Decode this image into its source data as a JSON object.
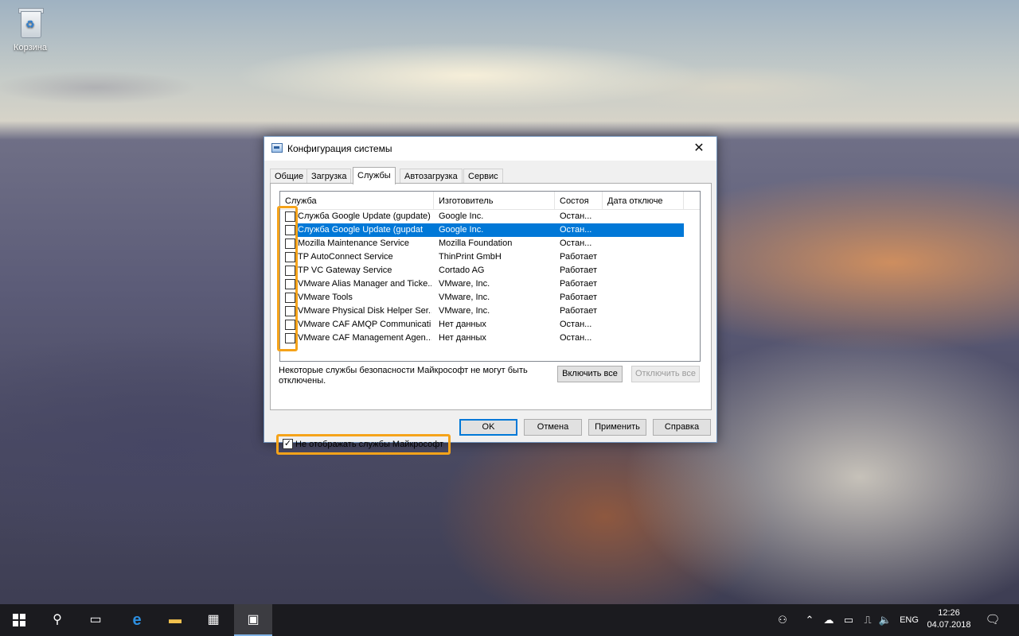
{
  "desktop": {
    "recycle_bin_label": "Корзина"
  },
  "dialog": {
    "title": "Конфигурация системы",
    "close_glyph": "✕",
    "tabs": [
      "Общие",
      "Загрузка",
      "Службы",
      "Автозагрузка",
      "Сервис"
    ],
    "active_tab": "Службы",
    "columns": [
      "Служба",
      "Изготовитель",
      "Состоя",
      "Дата отключе"
    ],
    "rows": [
      {
        "service": "Служба Google Update (gupdate)",
        "manufacturer": "Google Inc.",
        "status": "Остан...",
        "date": "",
        "checked": false,
        "selected": false
      },
      {
        "service": "Служба Google Update (gupdat",
        "manufacturer": "Google Inc.",
        "status": "Остан...",
        "date": "",
        "checked": false,
        "selected": true
      },
      {
        "service": "Mozilla Maintenance Service",
        "manufacturer": "Mozilla Foundation",
        "status": "Остан...",
        "date": "",
        "checked": false,
        "selected": false
      },
      {
        "service": "TP AutoConnect Service",
        "manufacturer": "ThinPrint GmbH",
        "status": "Работает",
        "date": "",
        "checked": false,
        "selected": false
      },
      {
        "service": "TP VC Gateway Service",
        "manufacturer": "Cortado AG",
        "status": "Работает",
        "date": "",
        "checked": false,
        "selected": false
      },
      {
        "service": "VMware Alias Manager and Ticke...",
        "manufacturer": "VMware, Inc.",
        "status": "Работает",
        "date": "",
        "checked": false,
        "selected": false
      },
      {
        "service": "VMware Tools",
        "manufacturer": "VMware, Inc.",
        "status": "Работает",
        "date": "",
        "checked": false,
        "selected": false
      },
      {
        "service": "VMware Physical Disk Helper Ser...",
        "manufacturer": "VMware, Inc.",
        "status": "Работает",
        "date": "",
        "checked": false,
        "selected": false
      },
      {
        "service": "VMware CAF AMQP Communicati...",
        "manufacturer": "Нет данных",
        "status": "Остан...",
        "date": "",
        "checked": false,
        "selected": false
      },
      {
        "service": "VMware CAF Management Agen...",
        "manufacturer": "Нет данных",
        "status": "Остан...",
        "date": "",
        "checked": false,
        "selected": false
      }
    ],
    "note": "Некоторые службы безопасности Майкрософт не могут быть отключены.",
    "enable_all": "Включить все",
    "disable_all": "Отключить все",
    "hide_ms_label": "Не отображать службы Майкрософт",
    "hide_ms_checked": true,
    "buttons": {
      "ok": "OK",
      "cancel": "Отмена",
      "apply": "Применить",
      "help": "Справка"
    },
    "highlight_color": "#f5a31a",
    "selection_color": "#0078d7"
  },
  "taskbar": {
    "language": "ENG",
    "time": "12:26",
    "date": "04.07.2018",
    "icons": [
      "start-icon",
      "search-icon",
      "task-view-icon",
      "edge-icon",
      "file-explorer-icon",
      "store-icon",
      "msconfig-icon"
    ]
  }
}
